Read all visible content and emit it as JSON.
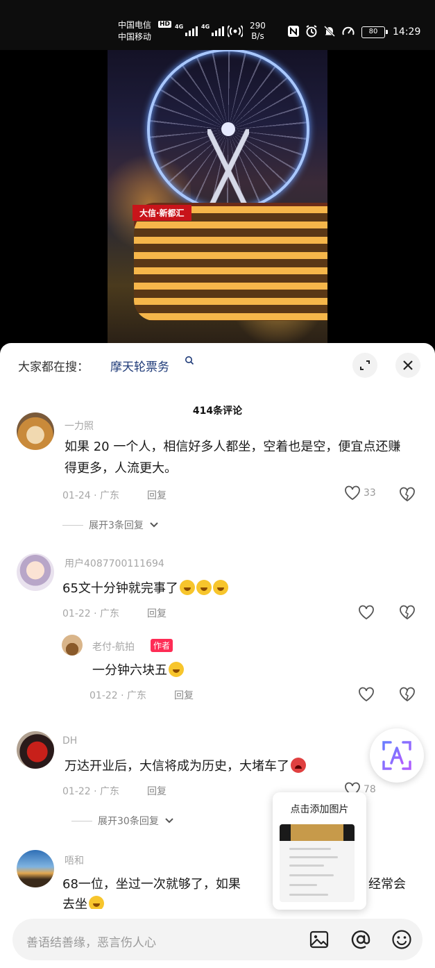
{
  "status_bar": {
    "carrier1": "中国电信",
    "carrier2": "中国移动",
    "hd": "HD",
    "net1": "4G",
    "net2": "4G",
    "speed_value": "290",
    "speed_unit": "B/s",
    "battery": "80",
    "time": "14:29",
    "icons": [
      "nfc-icon",
      "alarm-icon",
      "mute-icon",
      "speed-icon"
    ]
  },
  "video": {
    "sign_text": "大信·新都汇"
  },
  "sheet": {
    "search_prefix": "大家都在搜：",
    "search_keyword": "摩天轮票务",
    "comment_count": "414条评论",
    "comments": [
      {
        "username": "一力照",
        "text": "如果 20 一个人，相信好多人都坐，空着也是空，便宜点还赚得更多，人流更大。",
        "date": "01-24",
        "location": "广东",
        "reply": "回复",
        "likes": "33",
        "expand": "展开3条回复"
      },
      {
        "username": "用户4087700111694",
        "text": "65文十分钟就完事了",
        "date": "01-22",
        "location": "广东",
        "reply": "回复",
        "likes": ""
      },
      {
        "username": "DH",
        "text": "万达开业后，大信将成为历史，大堵车了",
        "date": "01-22",
        "location": "广东",
        "reply": "回复",
        "likes": "78",
        "expand": "展开30条回复"
      },
      {
        "username": "唔和",
        "text_line1": "68一位，坐过一次就够了，如果",
        "text_line1_end": "经常会",
        "text_line2": "去坐"
      }
    ],
    "author_reply": {
      "username": "老付-航拍",
      "badge": "作者",
      "text": "一分钟六块五",
      "date": "01-22",
      "location": "广东",
      "reply": "回复"
    }
  },
  "image_tip": {
    "title": "点击添加图片"
  },
  "input_bar": {
    "placeholder": "善语结善缘，恶言伤人心",
    "icons": [
      "image-icon",
      "at-icon",
      "emoji-icon"
    ]
  },
  "colors": {
    "accent": "#fe2c55",
    "link": "#1e3a78",
    "muted": "#a6a6a6"
  }
}
